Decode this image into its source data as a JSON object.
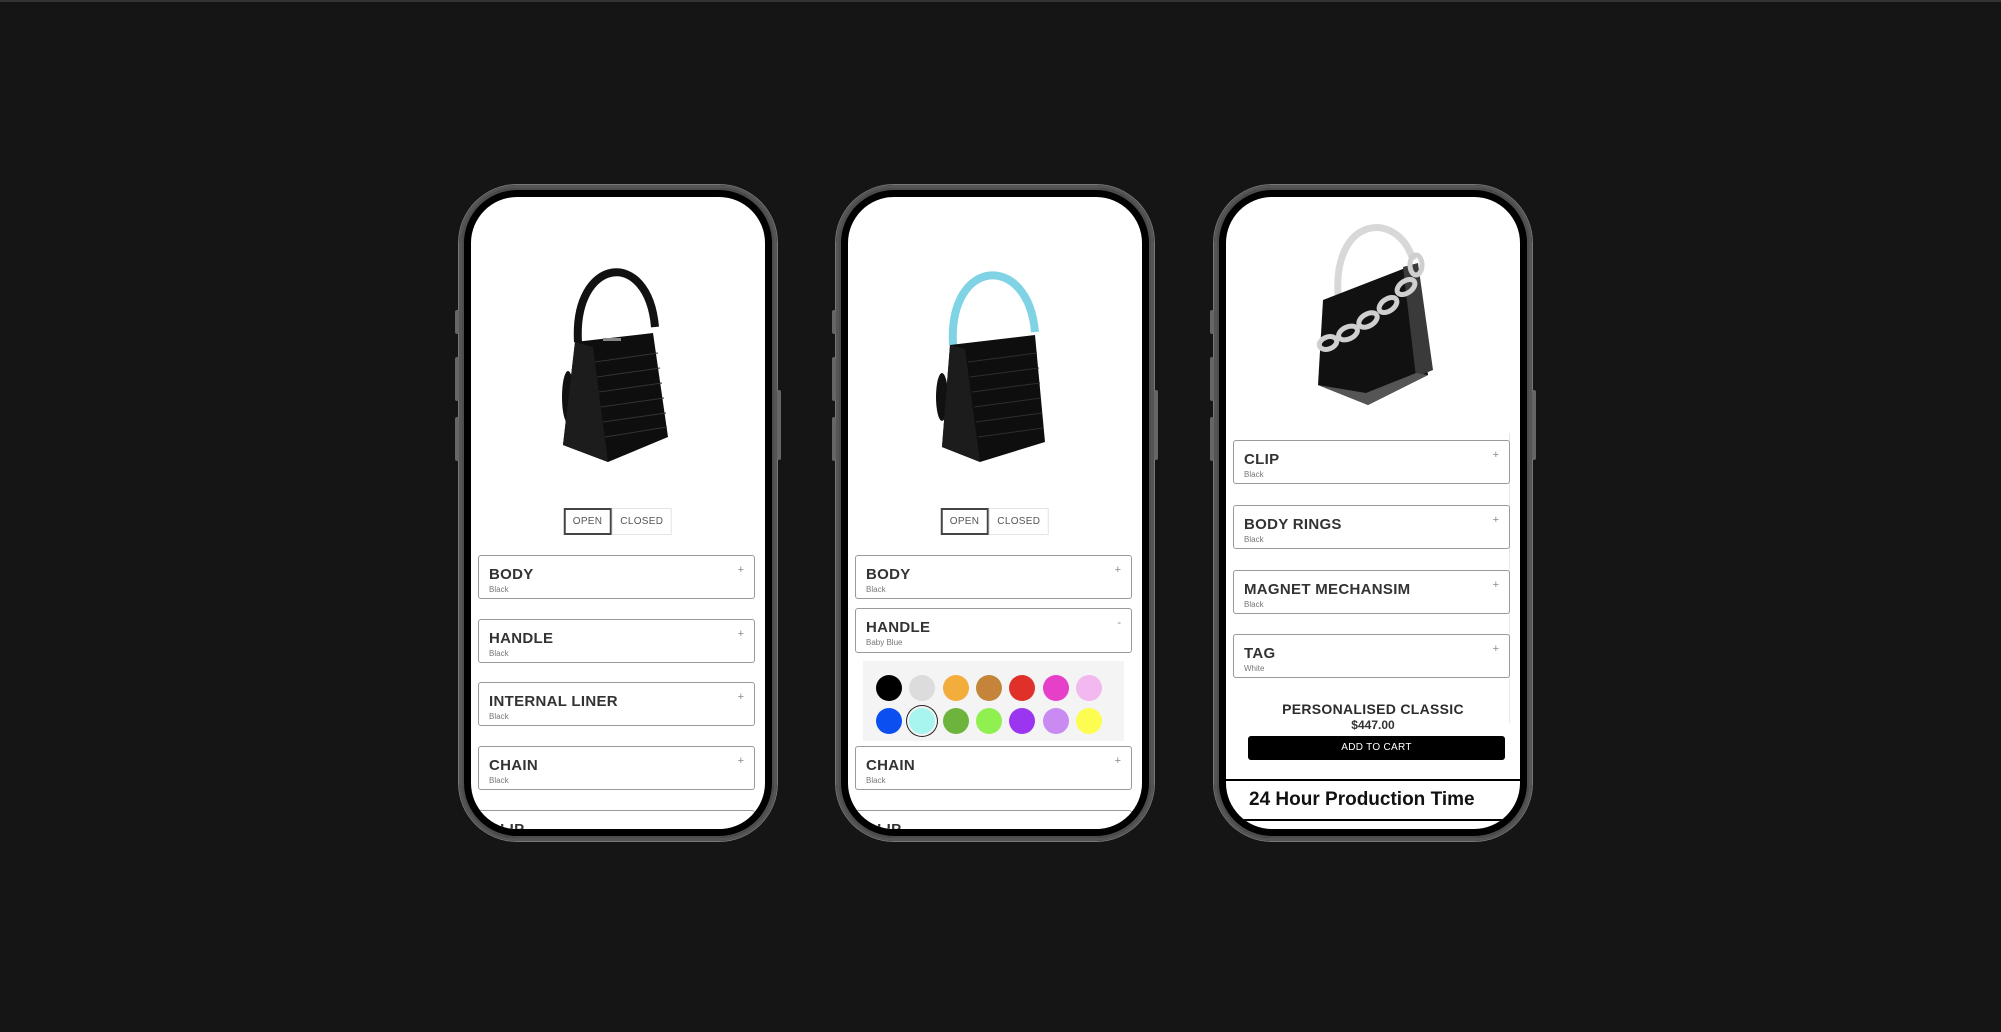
{
  "colors": {
    "background": "#151515",
    "screen": "#ffffff",
    "cart_button": "#000000",
    "baby_blue": "#7fd3e4"
  },
  "phones": [
    {
      "hero_image": "black-studded-handbag-black-handle",
      "toggle": {
        "open_label": "OPEN",
        "closed_label": "CLOSED",
        "active": "OPEN"
      },
      "options": [
        {
          "title": "BODY",
          "value": "Black",
          "icon": "+"
        },
        {
          "title": "HANDLE",
          "value": "Black",
          "icon": "+"
        },
        {
          "title": "INTERNAL LINER",
          "value": "Black",
          "icon": "+"
        },
        {
          "title": "CHAIN",
          "value": "Black",
          "icon": "+"
        },
        {
          "title": "CLIP",
          "value": "",
          "icon": ""
        }
      ]
    },
    {
      "hero_image": "black-studded-handbag-baby-blue-handle",
      "toggle": {
        "open_label": "OPEN",
        "closed_label": "CLOSED",
        "active": "OPEN"
      },
      "options": [
        {
          "title": "BODY",
          "value": "Black",
          "icon": "+"
        },
        {
          "title": "HANDLE",
          "value": "Baby Blue",
          "icon": "-",
          "expanded": true
        },
        {
          "title": "CHAIN",
          "value": "Black",
          "icon": "+"
        },
        {
          "title": "CLIP",
          "value": "",
          "icon": ""
        }
      ],
      "swatches": [
        {
          "name": "Black",
          "color": "#000000"
        },
        {
          "name": "Light Grey",
          "color": "#dcdcdc"
        },
        {
          "name": "Orange",
          "color": "#f2ad3d"
        },
        {
          "name": "Tan",
          "color": "#c4843a"
        },
        {
          "name": "Red",
          "color": "#e0302a"
        },
        {
          "name": "Magenta",
          "color": "#e63fc8"
        },
        {
          "name": "Pink",
          "color": "#f2b8ef"
        },
        {
          "name": "Blue",
          "color": "#0b4ff0"
        },
        {
          "name": "Baby Blue",
          "color": "#a8f5ef",
          "selected": true
        },
        {
          "name": "Green",
          "color": "#6cb43c"
        },
        {
          "name": "Lime",
          "color": "#8ff04f"
        },
        {
          "name": "Purple",
          "color": "#9b35ef"
        },
        {
          "name": "Lilac",
          "color": "#c98af2"
        },
        {
          "name": "Yellow",
          "color": "#fdfc50"
        }
      ]
    },
    {
      "hero_image": "black-studded-handbag-white-handle-white-chain",
      "options": [
        {
          "title": "CLIP",
          "value": "Black",
          "icon": "+"
        },
        {
          "title": "BODY RINGS",
          "value": "Black",
          "icon": "+"
        },
        {
          "title": "MAGNET MECHANSIM",
          "value": "Black",
          "icon": "+"
        },
        {
          "title": "TAG",
          "value": "White",
          "icon": "+"
        }
      ],
      "product": {
        "name": "PERSONALISED CLASSIC",
        "price": "$447.00",
        "cart_label": "ADD TO CART"
      },
      "ticker": [
        "24 Hour Production Time",
        "24 Hour Production Time"
      ]
    }
  ]
}
